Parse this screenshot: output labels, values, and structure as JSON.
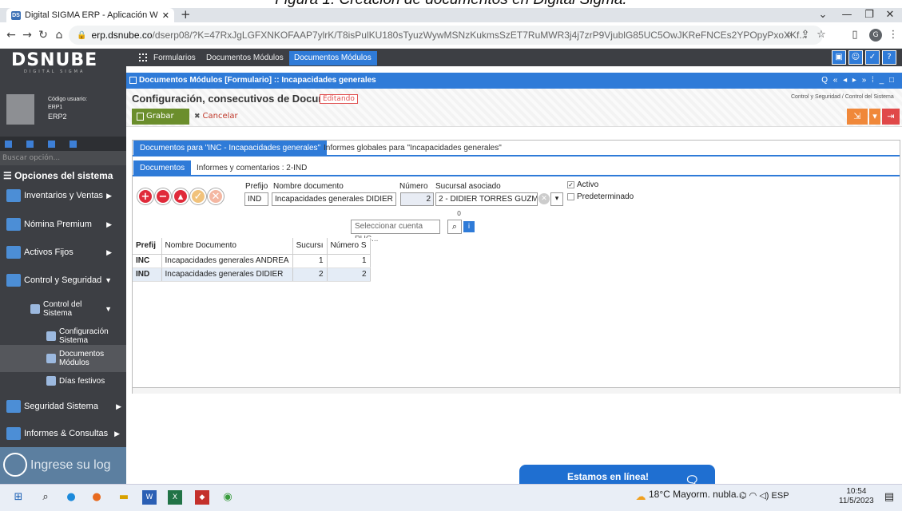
{
  "caption": "Figura 1: Creación de documentos en Digital Sigma.",
  "browser": {
    "tab_title": "Digital SIGMA ERP - Aplicación W",
    "url_domain": "erp.dsnube.co",
    "url_path": "/dserp08/?K=47RxJgLGFXNKOFAAP7ylrK/T8isPulKU180sTyuzWywMSNzKukmsSzET7RuMWR3j4j7zrP9VjublG85UC5OwJKReFNCEs2YPOpyPxoXKf...",
    "profile_initial": "G"
  },
  "sidebar": {
    "logo": "DSNUBE",
    "logo_sub": "DIGITAL SIGMA",
    "user_label": "Código usuario:",
    "user_line1": "ERP1",
    "user_line2": "ERP2",
    "search_placeholder": "Buscar opción...",
    "options_title": "Opciones del sistema",
    "items": [
      {
        "label": "Inventarios y Ventas"
      },
      {
        "label": "Nómina Premium"
      },
      {
        "label": "Activos Fijos"
      },
      {
        "label": "Control y Seguridad"
      },
      {
        "label": "Control del Sistema"
      },
      {
        "label": "Configuración Sistema"
      },
      {
        "label": "Documentos Módulos"
      },
      {
        "label": "Días festivos"
      },
      {
        "label": "Seguridad Sistema"
      },
      {
        "label": "Informes & Consultas"
      }
    ],
    "bottom_text": "Ingrese su log"
  },
  "appbar": {
    "tabs": [
      "Formularios",
      "Documentos Módulos",
      "Documentos Módulos"
    ]
  },
  "window": {
    "title": "Documentos Módulos [Formulario] :: Incapacidades generales",
    "controls": "Q « ◂ ▸ » ⁞ _ □",
    "page_title": "Configuración, consecutivos de Documentos",
    "status": "Editando",
    "breadcrumb": "Control y Seguridad / Control del Sistema",
    "save_label": "Grabar",
    "cancel_label": "Cancelar"
  },
  "tabs_main": [
    "Documentos para \"INC - Incapacidades generales\"",
    "Informes globales para \"Incapacidades generales\""
  ],
  "tabs_sub": [
    "Documentos",
    "Informes y comentarios : 2-IND"
  ],
  "form": {
    "prefix_label": "Prefijo",
    "prefix_value": "IND",
    "name_label": "Nombre documento",
    "name_value": "Incapacidades generales DIDIER",
    "number_label": "Número",
    "number_value": "2",
    "branch_label": "Sucursal asociado",
    "branch_value": "2 - DIDIER TORRES GUZMAN",
    "active_label": "Activo",
    "default_label": "Predeterminado",
    "zero": "0",
    "puc_placeholder": "Seleccionar cuenta PUC..."
  },
  "table": {
    "headers": [
      "Prefij",
      "Nombre Documento",
      "Sucursı",
      "Número S"
    ],
    "rows": [
      [
        "INC",
        "Incapacidades generales ANDREA",
        "1",
        "1"
      ],
      [
        "IND",
        "Incapacidades generales DIDIER",
        "2",
        "2"
      ]
    ]
  },
  "chat": {
    "label": "Estamos en línea!"
  },
  "taskbar": {
    "weather": "18°C  Mayorm. nubla...",
    "lang": "ESP",
    "time": "10:54",
    "date": "11/5/2023"
  }
}
